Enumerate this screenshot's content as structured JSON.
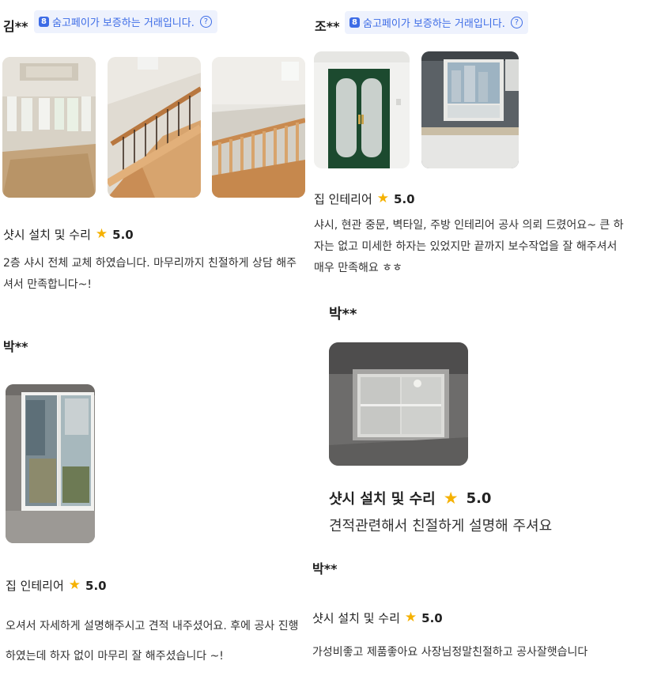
{
  "badge": {
    "text": "숨고페이가 보증하는 거래입니다.",
    "logo_glyph": "8",
    "help_glyph": "?",
    "color": "#3d6ce6",
    "bg": "#eef2fd"
  },
  "star_color": "#f5b100",
  "reviews": [
    {
      "author": "김**",
      "has_badge": true,
      "photos": [
        "bay-window-room",
        "wooden-staircase",
        "upper-floor-railing"
      ],
      "service": "샷시 설치 및 수리",
      "rating": "5.0",
      "text": "2층 샤시 전체 교체 하였습니다. 마무리까지 친절하게 상담 해주셔서 만족합니다~!"
    },
    {
      "author": "박**",
      "has_badge": false,
      "photos": [
        "sliding-balcony-window"
      ],
      "service": "집 인테리어",
      "rating": "5.0",
      "text": "오셔서 자세하게 설명해주시고 견적 내주셨어요.  후에 공사 진행하였는데 하자 없이 마무리 잘 해주셨습니다 ~!"
    },
    {
      "author": "조**",
      "has_badge": true,
      "photos": [
        "green-entrance-door",
        "kitchen-window"
      ],
      "service": "집 인테리어",
      "rating": "5.0",
      "text": "샤시, 현관 중문, 벽타일, 주방 인테리어 공사 의뢰 드렸어요~ 큰 하자는 없고 미세한 하자는 있었지만 끝까지 보수작업을 잘 해주셔서 매우 만족해요 ㅎㅎ"
    },
    {
      "author": "박**",
      "has_badge": false,
      "photos": [
        "white-sash-window"
      ],
      "service": "샷시 설치 및 수리",
      "rating": "5.0",
      "text": "견적관련해서 친절하게 설명해 주셔요"
    },
    {
      "author": "박**",
      "has_badge": false,
      "photos": [],
      "service": "샷시 설치 및 수리",
      "rating": "5.0",
      "text": "가성비좋고 제품좋아요 사장님정말친절하고 공사잘햇습니다"
    }
  ]
}
